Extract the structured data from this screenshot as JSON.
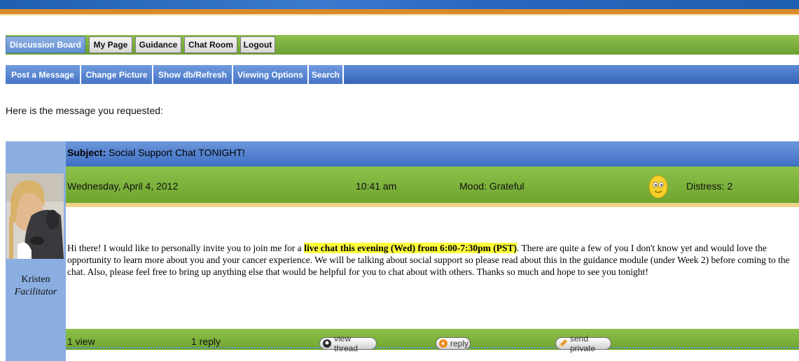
{
  "nav": {
    "tabs": [
      {
        "label": "Discussion Board"
      },
      {
        "label": "My Page"
      },
      {
        "label": "Guidance"
      },
      {
        "label": "Chat Room"
      },
      {
        "label": "Logout"
      }
    ],
    "subtabs": [
      {
        "label": "Post a Message"
      },
      {
        "label": "Change Picture"
      },
      {
        "label": "Show db/Refresh"
      },
      {
        "label": "Viewing Options"
      },
      {
        "label": "Search"
      }
    ]
  },
  "intro": "Here is the message you requested:",
  "message": {
    "subject_label": "Subject:",
    "subject": "Social Support Chat TONIGHT!",
    "date": "Wednesday, April 4, 2012",
    "time": "10:41 am",
    "mood": "Mood: Grateful",
    "mood_icon": "smiley-icon",
    "distress": "Distress: 2",
    "author": {
      "name": "Kristen",
      "role": "Facilitator"
    },
    "body_before": "Hi there!  I would like to personally invite you to join me for a ",
    "body_highlight": "live chat this evening (Wed) from 6:00-7:30pm (PST)",
    "body_after": ".  There are quite a few of you I don't know yet and would love the opportunity to learn more about you and your cancer experience.  We will be talking about social support so please read about this in the guidance module (under Week 2) before coming to the chat.  Also, please feel free to bring up anything else that would be helpful for you to chat about with others.  Thanks so much and hope to see you tonight!",
    "views": "1 view",
    "replies": "1 reply",
    "actions": {
      "view_thread": "view thread",
      "reply": "reply",
      "send_private": "send private"
    }
  },
  "colors": {
    "nav_green": "#7bb03c",
    "nav_blue": "#4a78c8",
    "highlight": "#ffff3a"
  }
}
